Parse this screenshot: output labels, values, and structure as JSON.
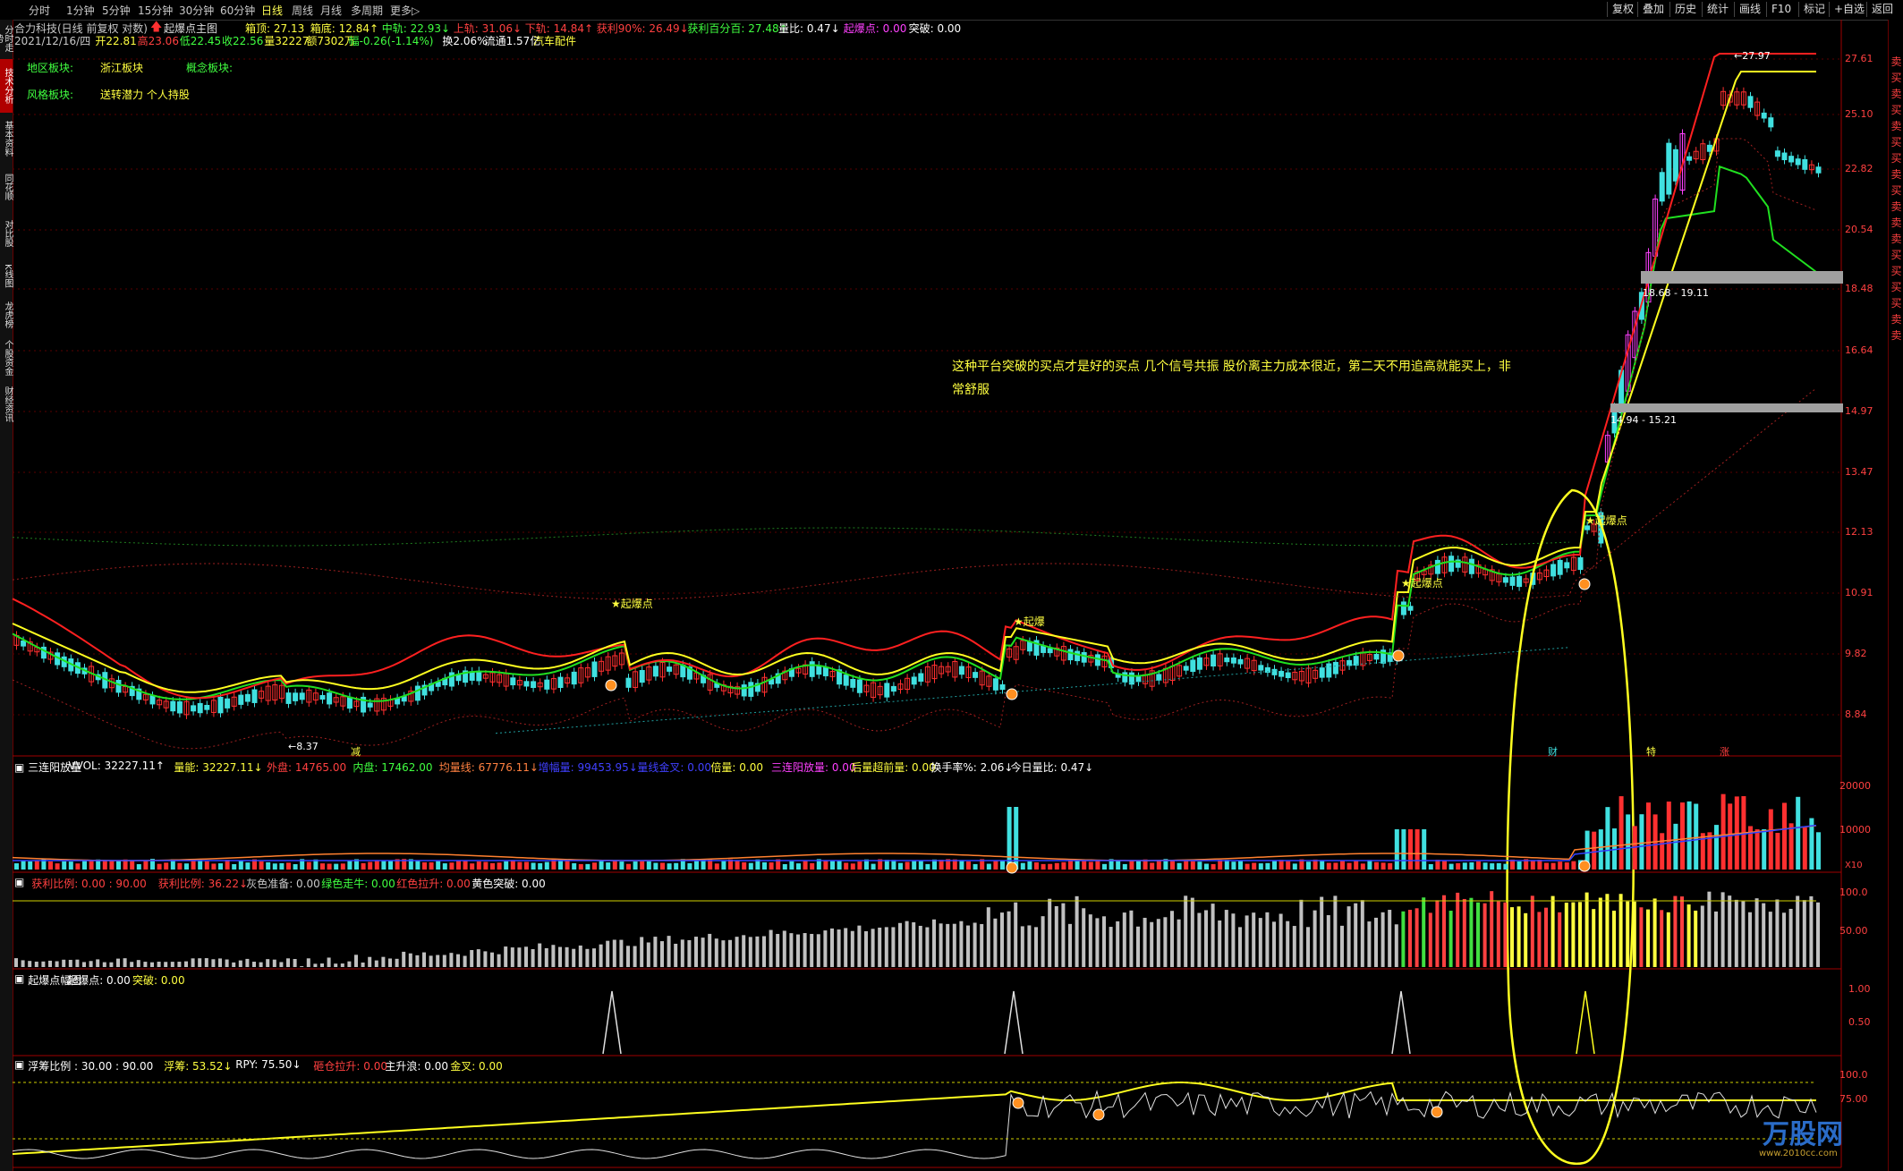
{
  "topbar": {
    "tabs": [
      "分时",
      "1分钟",
      "5分钟",
      "15分钟",
      "30分钟",
      "60分钟",
      "日线",
      "周线",
      "月线",
      "多周期",
      "更多▷"
    ],
    "active_tab": "日线",
    "right_buttons": [
      "复权",
      "叠加",
      "历史",
      "统计",
      "画线",
      "F10",
      "标记",
      "+自选",
      "返回"
    ]
  },
  "left_sidebar": [
    "分时走势",
    "技术分析",
    "基本资料",
    "同花顺",
    "对比股",
    "K线图",
    "龙虎榜",
    "个股资金",
    "财经资讯"
  ],
  "left_sidebar_selected": "技术分析",
  "right_sidebar": [
    "卖",
    "买",
    "卖",
    "买",
    "卖",
    "买",
    "买",
    "卖",
    "买",
    "卖",
    "卖",
    "卖",
    "买",
    "买",
    "买",
    "买",
    "卖",
    "卖"
  ],
  "header": {
    "stock": "合力科技(日线 前复权 对数)",
    "indicator": "起爆点主图",
    "fields": [
      {
        "t": "箱顶: 27.13",
        "c": "#ffff40"
      },
      {
        "t": "箱底: 12.84↑",
        "c": "#ffff40"
      },
      {
        "t": "中轨: 22.93↓",
        "c": "#40ff40"
      },
      {
        "t": "上轨: 31.06↓",
        "c": "#ff4040"
      },
      {
        "t": "下轨: 14.84↑",
        "c": "#ff4040"
      },
      {
        "t": "获利90%: 26.49↓",
        "c": "#ff4040"
      },
      {
        "t": "获利百分百: 27.48↑",
        "c": "#40ff40"
      },
      {
        "t": "量比: 0.47↓",
        "c": "#ffffff"
      },
      {
        "t": "起爆点: 0.00",
        "c": "#ff40ff"
      },
      {
        "t": "突破: 0.00",
        "c": "#ffffff"
      }
    ],
    "line2": [
      {
        "t": "2021/12/16/四",
        "c": "#c8c8c8"
      },
      {
        "t": "开22.81",
        "c": "#ffff40"
      },
      {
        "t": "高23.06",
        "c": "#ff4040"
      },
      {
        "t": "低22.45",
        "c": "#40ff40"
      },
      {
        "t": "收22.56",
        "c": "#40ff40"
      },
      {
        "t": "量32227",
        "c": "#ffff40"
      },
      {
        "t": "额7302万",
        "c": "#ffff40"
      },
      {
        "t": "幅-0.26(-1.14%)",
        "c": "#40ff40"
      },
      {
        "t": "换2.06%",
        "c": "#ffffff"
      },
      {
        "t": "流通1.57亿",
        "c": "#ffffff"
      },
      {
        "t": "汽车配件",
        "c": "#ffff40"
      }
    ],
    "region_label": "地区板块:",
    "region_value": "浙江板块",
    "concept_label": "概念板块:",
    "style_label": "风格板块:",
    "style_value": "送转潜力 个人持股"
  },
  "annotation": {
    "line1": "这种平台突破的买点才是好的买点 几个信号共振 股价离主力成本很近，第二天不用追高就能买上，非",
    "line2": "常舒服"
  },
  "chart_labels": {
    "burst1": "★起爆点",
    "burst2": "★起爆",
    "burst3": "★起爆点",
    "burst4": "★起爆点",
    "low_mark": "←8.37",
    "high_mark": "←27.97",
    "box1": "18.68 - 19.11",
    "box2": "14.94 - 15.21",
    "xlabels": [
      "减",
      "财",
      "特",
      "涨"
    ]
  },
  "y_axis_main": [
    "27.61",
    "25.10",
    "22.82",
    "20.54",
    "18.48",
    "16.64",
    "14.97",
    "13.47",
    "12.13",
    "10.91",
    "9.82",
    "8.84"
  ],
  "panel2": {
    "title": "三连阳放量",
    "fields": [
      {
        "t": "VVOL: 32227.11↑",
        "c": "#ffffff"
      },
      {
        "t": "量能: 32227.11↓",
        "c": "#ffff40"
      },
      {
        "t": "外盘: 14765.00",
        "c": "#ff4040"
      },
      {
        "t": "内盘: 17462.00",
        "c": "#40ff40"
      },
      {
        "t": "均量线: 67776.11↓",
        "c": "#ff8040"
      },
      {
        "t": "增幅量: 99453.95↓",
        "c": "#4040ff"
      },
      {
        "t": "量线金叉: 0.00",
        "c": "#4040ff"
      },
      {
        "t": "倍量: 0.00",
        "c": "#ffff40"
      },
      {
        "t": "三连阳放量: 0.00",
        "c": "#ff40ff"
      },
      {
        "t": "后量超前量: 0.00",
        "c": "#ffff40"
      },
      {
        "t": "换手率%: 2.06↓",
        "c": "#ffffff"
      },
      {
        "t": "今日量比: 0.47↓",
        "c": "#ffffff"
      }
    ],
    "ticks": [
      "20000",
      "10000"
    ],
    "unit": "X10"
  },
  "panel3": {
    "fields": [
      {
        "t": "获利比例: 0.00 : 90.00",
        "c": "#ff4040"
      },
      {
        "t": "获利比例: 36.22↓",
        "c": "#ff4040"
      },
      {
        "t": "灰色准备: 0.00",
        "c": "#c8c8c8"
      },
      {
        "t": "绿色走牛: 0.00",
        "c": "#40ff40"
      },
      {
        "t": "红色拉升: 0.00",
        "c": "#ff4040"
      },
      {
        "t": "黄色突破: 0.00",
        "c": "#ffffff"
      }
    ],
    "ticks": [
      "100.0",
      "50.00"
    ]
  },
  "panel4": {
    "fields": [
      {
        "t": "起爆点幅图",
        "c": "#ffffff"
      },
      {
        "t": "起爆点: 0.00",
        "c": "#ffffff"
      },
      {
        "t": "突破: 0.00",
        "c": "#ffff40"
      }
    ],
    "ticks": [
      "1.00",
      "0.50"
    ]
  },
  "panel5": {
    "fields": [
      {
        "t": "浮筹比例 : 30.00 : 90.00",
        "c": "#ffffff"
      },
      {
        "t": "浮筹: 53.52↓",
        "c": "#ffff40"
      },
      {
        "t": "RPY: 75.50↓",
        "c": "#ffffff"
      },
      {
        "t": "砸仓拉升: 0.00",
        "c": "#ff4040"
      },
      {
        "t": "主升浪: 0.00",
        "c": "#ffffff"
      },
      {
        "t": "金叉: 0.00",
        "c": "#ffff40"
      }
    ],
    "ticks": [
      "100.0",
      "75.00"
    ]
  },
  "watermark": {
    "name": "万股网",
    "url": "www.2010cc.com"
  },
  "colors": {
    "up": "#ff3030",
    "down": "#40e0e0",
    "ma_green": "#20e020",
    "ma_red": "#ff2020",
    "box_yellow": "#ffff20",
    "circle": "#ffff20"
  }
}
